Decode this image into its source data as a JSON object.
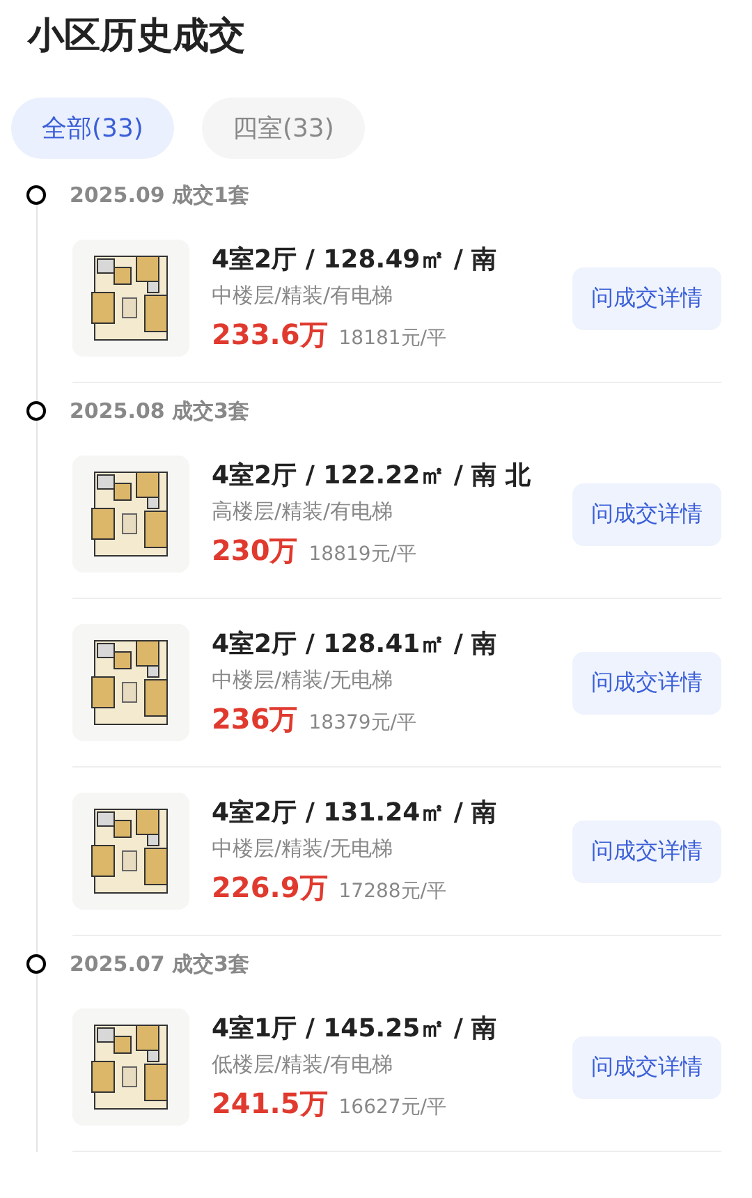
{
  "title": "小区历史成交",
  "tabs": [
    {
      "label": "全部(33)",
      "selected": true
    },
    {
      "label": "四室(33)",
      "selected": false
    }
  ],
  "groups": [
    {
      "header": "2025.09 成交1套",
      "items": [
        {
          "kind": "picture",
          "summary": "4室2厅 / 128.49㎡ / 南",
          "details": "中楼层/精装/有电梯",
          "price": "233.6万",
          "unit_price": "18181元/平",
          "button": "问成交详情"
        }
      ]
    },
    {
      "header": "2025.08 成交3套",
      "items": [
        {
          "kind": "picture",
          "summary": "4室2厅 / 122.22㎡ / 南 北",
          "details": "高楼层/精装/有电梯",
          "price": "230万",
          "unit_price": "18819元/平",
          "button": "问成交详情"
        },
        {
          "kind": "picture",
          "summary": "4室2厅 / 128.41㎡ / 南",
          "details": "中楼层/精装/无电梯",
          "price": "236万",
          "unit_price": "18379元/平",
          "button": "问成交详情"
        },
        {
          "kind": "picture",
          "summary": "4室2厅 / 131.24㎡ / 南",
          "details": "中楼层/精装/无电梯",
          "price": "226.9万",
          "unit_price": "17288元/平",
          "button": "问成交详情"
        }
      ]
    },
    {
      "header": "2025.07 成交3套",
      "items": [
        {
          "kind": "picture",
          "summary": "4室1厅 / 145.25㎡ / 南",
          "details": "低楼层/精装/有电梯",
          "price": "241.5万",
          "unit_price": "16627元/平",
          "button": "问成交详情"
        }
      ]
    }
  ]
}
